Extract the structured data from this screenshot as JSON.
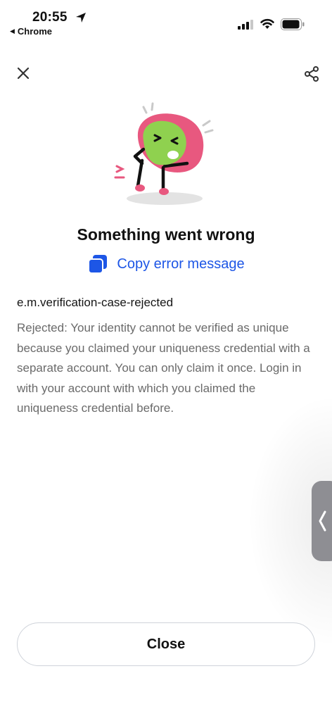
{
  "status_bar": {
    "time": "20:55",
    "back_app": "Chrome",
    "icons": [
      "location-arrow-icon",
      "signal-icon",
      "wifi-icon",
      "battery-icon"
    ]
  },
  "header": {
    "close_icon": "close-icon",
    "share_icon": "share-icon"
  },
  "error": {
    "illustration": "sick-character-illustration",
    "title": "Something went wrong",
    "copy_label": "Copy error message",
    "code": "e.m.verification-case-rejected",
    "description": "Rejected: Your identity cannot be verified as unique because you claimed your uniqueness credential with a separate account. You can only claim it once. Login in with your account with which you claimed the uniqueness credential before."
  },
  "footer": {
    "close_label": "Close"
  },
  "colors": {
    "accent": "#1d56e6",
    "blob_pink": "#e8587f",
    "face_green": "#8fd14f",
    "side_tab": "#8e8e93"
  }
}
